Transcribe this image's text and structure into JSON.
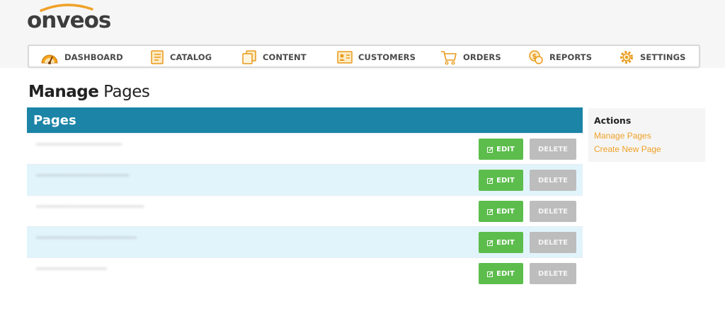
{
  "brand": {
    "logo_text": "onveos"
  },
  "nav": {
    "items": [
      {
        "label": "DASHBOARD",
        "icon": "dashboard-gauge-icon"
      },
      {
        "label": "CATALOG",
        "icon": "catalog-document-icon"
      },
      {
        "label": "CONTENT",
        "icon": "content-pages-icon"
      },
      {
        "label": "CUSTOMERS",
        "icon": "customers-card-icon"
      },
      {
        "label": "ORDERS",
        "icon": "orders-cart-icon"
      },
      {
        "label": "REPORTS",
        "icon": "reports-coins-icon"
      },
      {
        "label": "SETTINGS",
        "icon": "settings-gear-icon"
      }
    ]
  },
  "page": {
    "title_strong": "Manage",
    "title_rest": " Pages"
  },
  "pages_panel": {
    "header": "Pages",
    "rows": [
      {
        "title": "~~~~~~~~~~~~~~~~~~~~~~~",
        "edit_label": "EDIT",
        "delete_label": "DELETE"
      },
      {
        "title": "~~~~~~~~~~~~~~~~~~~~~~~~~",
        "edit_label": "EDIT",
        "delete_label": "DELETE"
      },
      {
        "title": "~~~~~~~~~~~~~~~~~~~~~~~~~~~~~",
        "edit_label": "EDIT",
        "delete_label": "DELETE"
      },
      {
        "title": "~~~~~~~~~~~~~~~~~~~~~~~~~~~",
        "edit_label": "EDIT",
        "delete_label": "DELETE"
      },
      {
        "title": "~~~~~~~~~~~~~~~~~~~",
        "edit_label": "EDIT",
        "delete_label": "DELETE"
      }
    ]
  },
  "actions": {
    "title": "Actions",
    "links": [
      "Manage Pages",
      "Create New Page"
    ]
  },
  "colors": {
    "accent_orange": "#f0a127",
    "panel_blue": "#1b84a7",
    "edit_green": "#5cbd4c",
    "delete_gray": "#bdbdbd",
    "row_alt": "#e2f4fb"
  }
}
